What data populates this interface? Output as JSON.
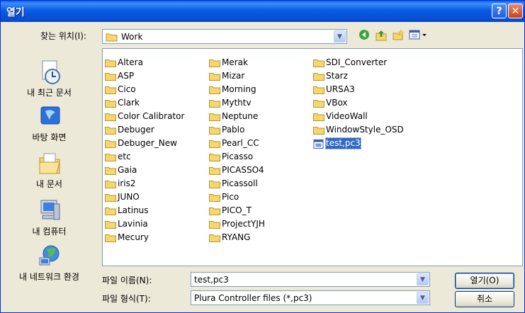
{
  "window": {
    "title": "열기",
    "help_label": "?",
    "close_label": "✕"
  },
  "lookin": {
    "label": "찾는 위치(I):",
    "value": "Work"
  },
  "toolbar": {
    "back_icon": "back-icon",
    "up_icon": "up-folder-icon",
    "newfolder_icon": "new-folder-icon",
    "views_icon": "views-menu-icon"
  },
  "places": [
    {
      "label": "내 최근 문서",
      "icon": "recent-documents-icon"
    },
    {
      "label": "바탕 화면",
      "icon": "desktop-icon"
    },
    {
      "label": "내 문서",
      "icon": "my-documents-icon"
    },
    {
      "label": "내 컴퓨터",
      "icon": "my-computer-icon"
    },
    {
      "label": "내 네트워크 환경",
      "icon": "network-places-icon"
    }
  ],
  "files": {
    "col1": [
      "Altera",
      "ASP",
      "Cico",
      "Clark",
      "Color Calibrator",
      "Debuger",
      "Debuger_New",
      "etc",
      "Gaia",
      "iris2",
      "JUNO",
      "Latinus",
      "Lavinia",
      "Mecury"
    ],
    "col2": [
      "Merak",
      "Mizar",
      "Morning",
      "Mythtv",
      "Neptune",
      "Pablo",
      "Pearl_CC",
      "Picasso",
      "PICASSO4",
      "Picassoll",
      "Pico",
      "PICO_T",
      "ProjectYJH",
      "RYANG"
    ],
    "col3": [
      "SDI_Converter",
      "Starz",
      "URSA3",
      "VBox",
      "VideoWall",
      "WindowStyle_OSD"
    ],
    "file": "test,pc3"
  },
  "filename": {
    "label": "파일 이름(N):",
    "value": "test,pc3"
  },
  "filetype": {
    "label": "파일 형식(T):",
    "value": "Plura Controller files (*,pc3)"
  },
  "buttons": {
    "open": "열기(O)",
    "cancel": "취소"
  },
  "colors": {
    "title_blue": "#0a5ee9",
    "folder_yellow": "#f5d76e",
    "selection": "#316ac5",
    "face": "#ece9d8"
  }
}
